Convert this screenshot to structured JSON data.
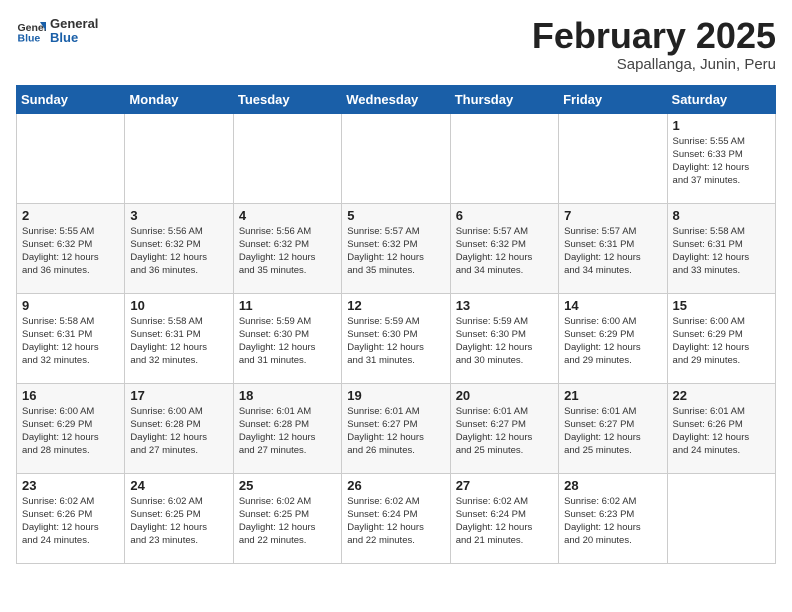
{
  "header": {
    "logo_general": "General",
    "logo_blue": "Blue",
    "month_title": "February 2025",
    "location": "Sapallanga, Junin, Peru"
  },
  "days_of_week": [
    "Sunday",
    "Monday",
    "Tuesday",
    "Wednesday",
    "Thursday",
    "Friday",
    "Saturday"
  ],
  "weeks": [
    [
      {
        "day": "",
        "info": ""
      },
      {
        "day": "",
        "info": ""
      },
      {
        "day": "",
        "info": ""
      },
      {
        "day": "",
        "info": ""
      },
      {
        "day": "",
        "info": ""
      },
      {
        "day": "",
        "info": ""
      },
      {
        "day": "1",
        "info": "Sunrise: 5:55 AM\nSunset: 6:33 PM\nDaylight: 12 hours\nand 37 minutes."
      }
    ],
    [
      {
        "day": "2",
        "info": "Sunrise: 5:55 AM\nSunset: 6:32 PM\nDaylight: 12 hours\nand 36 minutes."
      },
      {
        "day": "3",
        "info": "Sunrise: 5:56 AM\nSunset: 6:32 PM\nDaylight: 12 hours\nand 36 minutes."
      },
      {
        "day": "4",
        "info": "Sunrise: 5:56 AM\nSunset: 6:32 PM\nDaylight: 12 hours\nand 35 minutes."
      },
      {
        "day": "5",
        "info": "Sunrise: 5:57 AM\nSunset: 6:32 PM\nDaylight: 12 hours\nand 35 minutes."
      },
      {
        "day": "6",
        "info": "Sunrise: 5:57 AM\nSunset: 6:32 PM\nDaylight: 12 hours\nand 34 minutes."
      },
      {
        "day": "7",
        "info": "Sunrise: 5:57 AM\nSunset: 6:31 PM\nDaylight: 12 hours\nand 34 minutes."
      },
      {
        "day": "8",
        "info": "Sunrise: 5:58 AM\nSunset: 6:31 PM\nDaylight: 12 hours\nand 33 minutes."
      }
    ],
    [
      {
        "day": "9",
        "info": "Sunrise: 5:58 AM\nSunset: 6:31 PM\nDaylight: 12 hours\nand 32 minutes."
      },
      {
        "day": "10",
        "info": "Sunrise: 5:58 AM\nSunset: 6:31 PM\nDaylight: 12 hours\nand 32 minutes."
      },
      {
        "day": "11",
        "info": "Sunrise: 5:59 AM\nSunset: 6:30 PM\nDaylight: 12 hours\nand 31 minutes."
      },
      {
        "day": "12",
        "info": "Sunrise: 5:59 AM\nSunset: 6:30 PM\nDaylight: 12 hours\nand 31 minutes."
      },
      {
        "day": "13",
        "info": "Sunrise: 5:59 AM\nSunset: 6:30 PM\nDaylight: 12 hours\nand 30 minutes."
      },
      {
        "day": "14",
        "info": "Sunrise: 6:00 AM\nSunset: 6:29 PM\nDaylight: 12 hours\nand 29 minutes."
      },
      {
        "day": "15",
        "info": "Sunrise: 6:00 AM\nSunset: 6:29 PM\nDaylight: 12 hours\nand 29 minutes."
      }
    ],
    [
      {
        "day": "16",
        "info": "Sunrise: 6:00 AM\nSunset: 6:29 PM\nDaylight: 12 hours\nand 28 minutes."
      },
      {
        "day": "17",
        "info": "Sunrise: 6:00 AM\nSunset: 6:28 PM\nDaylight: 12 hours\nand 27 minutes."
      },
      {
        "day": "18",
        "info": "Sunrise: 6:01 AM\nSunset: 6:28 PM\nDaylight: 12 hours\nand 27 minutes."
      },
      {
        "day": "19",
        "info": "Sunrise: 6:01 AM\nSunset: 6:27 PM\nDaylight: 12 hours\nand 26 minutes."
      },
      {
        "day": "20",
        "info": "Sunrise: 6:01 AM\nSunset: 6:27 PM\nDaylight: 12 hours\nand 25 minutes."
      },
      {
        "day": "21",
        "info": "Sunrise: 6:01 AM\nSunset: 6:27 PM\nDaylight: 12 hours\nand 25 minutes."
      },
      {
        "day": "22",
        "info": "Sunrise: 6:01 AM\nSunset: 6:26 PM\nDaylight: 12 hours\nand 24 minutes."
      }
    ],
    [
      {
        "day": "23",
        "info": "Sunrise: 6:02 AM\nSunset: 6:26 PM\nDaylight: 12 hours\nand 24 minutes."
      },
      {
        "day": "24",
        "info": "Sunrise: 6:02 AM\nSunset: 6:25 PM\nDaylight: 12 hours\nand 23 minutes."
      },
      {
        "day": "25",
        "info": "Sunrise: 6:02 AM\nSunset: 6:25 PM\nDaylight: 12 hours\nand 22 minutes."
      },
      {
        "day": "26",
        "info": "Sunrise: 6:02 AM\nSunset: 6:24 PM\nDaylight: 12 hours\nand 22 minutes."
      },
      {
        "day": "27",
        "info": "Sunrise: 6:02 AM\nSunset: 6:24 PM\nDaylight: 12 hours\nand 21 minutes."
      },
      {
        "day": "28",
        "info": "Sunrise: 6:02 AM\nSunset: 6:23 PM\nDaylight: 12 hours\nand 20 minutes."
      },
      {
        "day": "",
        "info": ""
      }
    ]
  ]
}
